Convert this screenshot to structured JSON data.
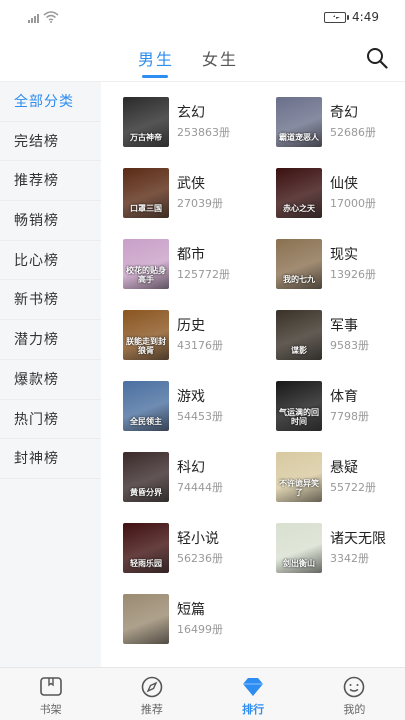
{
  "status_bar": {
    "time": "4:49"
  },
  "header": {
    "tabs": [
      {
        "label": "男生",
        "active": true
      },
      {
        "label": "女生",
        "active": false
      }
    ]
  },
  "sidebar": {
    "items": [
      {
        "label": "全部分类",
        "active": true
      },
      {
        "label": "完结榜"
      },
      {
        "label": "推荐榜"
      },
      {
        "label": "畅销榜"
      },
      {
        "label": "比心榜"
      },
      {
        "label": "新书榜"
      },
      {
        "label": "潜力榜"
      },
      {
        "label": "爆款榜"
      },
      {
        "label": "热门榜"
      },
      {
        "label": "封神榜"
      }
    ]
  },
  "categories": [
    {
      "name": "玄幻",
      "count": "253863册",
      "cover_title": "万古神帝",
      "cover_color": "#2a2a2a"
    },
    {
      "name": "奇幻",
      "count": "52686册",
      "cover_title": "霸道宠恶人",
      "cover_color": "#6a6f8a"
    },
    {
      "name": "武侠",
      "count": "27039册",
      "cover_title": "口罩三国",
      "cover_color": "#5a2a14"
    },
    {
      "name": "仙侠",
      "count": "17000册",
      "cover_title": "赤心之天",
      "cover_color": "#3a1010"
    },
    {
      "name": "都市",
      "count": "125772册",
      "cover_title": "校花的贴身高手",
      "cover_color": "#c9a0c8"
    },
    {
      "name": "现实",
      "count": "13926册",
      "cover_title": "我的七九",
      "cover_color": "#8a7050"
    },
    {
      "name": "历史",
      "count": "43176册",
      "cover_title": "朕能走到封狼胥",
      "cover_color": "#8a5520"
    },
    {
      "name": "军事",
      "count": "9583册",
      "cover_title": "谍影",
      "cover_color": "#3a3228"
    },
    {
      "name": "游戏",
      "count": "54453册",
      "cover_title": "全民领主",
      "cover_color": "#4a6fa0"
    },
    {
      "name": "体育",
      "count": "7798册",
      "cover_title": "气运满的回时间",
      "cover_color": "#181818"
    },
    {
      "name": "科幻",
      "count": "74444册",
      "cover_title": "黄昏分界",
      "cover_color": "#3a2a2a"
    },
    {
      "name": "悬疑",
      "count": "55722册",
      "cover_title": "不许诡异笑了",
      "cover_color": "#d8c9a0"
    },
    {
      "name": "轻小说",
      "count": "56236册",
      "cover_title": "轻雨乐园",
      "cover_color": "#401010"
    },
    {
      "name": "诸天无限",
      "count": "3342册",
      "cover_title": "剑出衡山",
      "cover_color": "#d8e0d0"
    },
    {
      "name": "短篇",
      "count": "16499册",
      "cover_title": "",
      "cover_color": "#9a8a70"
    }
  ],
  "tabbar": {
    "items": [
      {
        "label": "书架",
        "icon": "bookshelf-icon"
      },
      {
        "label": "推荐",
        "icon": "compass-icon"
      },
      {
        "label": "排行",
        "icon": "ranking-icon",
        "active": true
      },
      {
        "label": "我的",
        "icon": "profile-icon"
      }
    ]
  },
  "colors": {
    "accent": "#2e8df0"
  }
}
